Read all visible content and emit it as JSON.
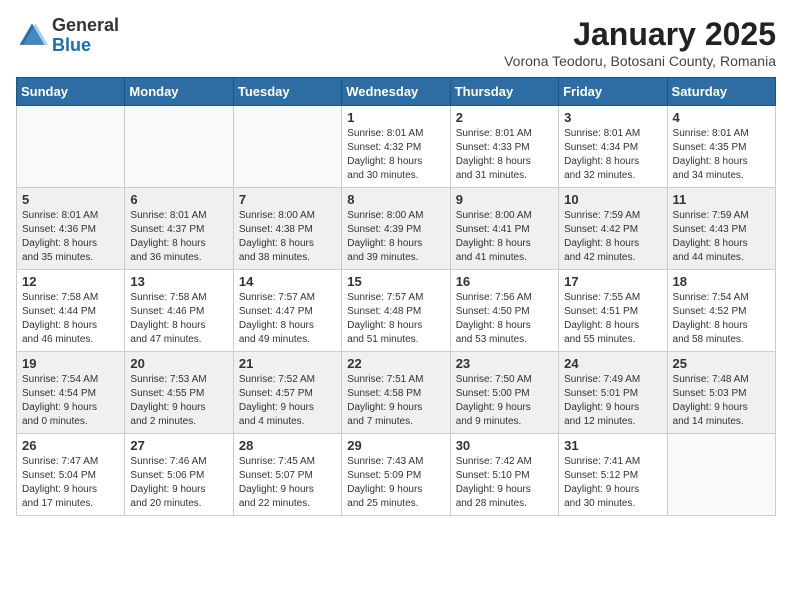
{
  "logo": {
    "general": "General",
    "blue": "Blue"
  },
  "title": "January 2025",
  "subtitle": "Vorona Teodoru, Botosani County, Romania",
  "weekdays": [
    "Sunday",
    "Monday",
    "Tuesday",
    "Wednesday",
    "Thursday",
    "Friday",
    "Saturday"
  ],
  "weeks": [
    [
      {
        "day": "",
        "info": ""
      },
      {
        "day": "",
        "info": ""
      },
      {
        "day": "",
        "info": ""
      },
      {
        "day": "1",
        "info": "Sunrise: 8:01 AM\nSunset: 4:32 PM\nDaylight: 8 hours\nand 30 minutes."
      },
      {
        "day": "2",
        "info": "Sunrise: 8:01 AM\nSunset: 4:33 PM\nDaylight: 8 hours\nand 31 minutes."
      },
      {
        "day": "3",
        "info": "Sunrise: 8:01 AM\nSunset: 4:34 PM\nDaylight: 8 hours\nand 32 minutes."
      },
      {
        "day": "4",
        "info": "Sunrise: 8:01 AM\nSunset: 4:35 PM\nDaylight: 8 hours\nand 34 minutes."
      }
    ],
    [
      {
        "day": "5",
        "info": "Sunrise: 8:01 AM\nSunset: 4:36 PM\nDaylight: 8 hours\nand 35 minutes."
      },
      {
        "day": "6",
        "info": "Sunrise: 8:01 AM\nSunset: 4:37 PM\nDaylight: 8 hours\nand 36 minutes."
      },
      {
        "day": "7",
        "info": "Sunrise: 8:00 AM\nSunset: 4:38 PM\nDaylight: 8 hours\nand 38 minutes."
      },
      {
        "day": "8",
        "info": "Sunrise: 8:00 AM\nSunset: 4:39 PM\nDaylight: 8 hours\nand 39 minutes."
      },
      {
        "day": "9",
        "info": "Sunrise: 8:00 AM\nSunset: 4:41 PM\nDaylight: 8 hours\nand 41 minutes."
      },
      {
        "day": "10",
        "info": "Sunrise: 7:59 AM\nSunset: 4:42 PM\nDaylight: 8 hours\nand 42 minutes."
      },
      {
        "day": "11",
        "info": "Sunrise: 7:59 AM\nSunset: 4:43 PM\nDaylight: 8 hours\nand 44 minutes."
      }
    ],
    [
      {
        "day": "12",
        "info": "Sunrise: 7:58 AM\nSunset: 4:44 PM\nDaylight: 8 hours\nand 46 minutes."
      },
      {
        "day": "13",
        "info": "Sunrise: 7:58 AM\nSunset: 4:46 PM\nDaylight: 8 hours\nand 47 minutes."
      },
      {
        "day": "14",
        "info": "Sunrise: 7:57 AM\nSunset: 4:47 PM\nDaylight: 8 hours\nand 49 minutes."
      },
      {
        "day": "15",
        "info": "Sunrise: 7:57 AM\nSunset: 4:48 PM\nDaylight: 8 hours\nand 51 minutes."
      },
      {
        "day": "16",
        "info": "Sunrise: 7:56 AM\nSunset: 4:50 PM\nDaylight: 8 hours\nand 53 minutes."
      },
      {
        "day": "17",
        "info": "Sunrise: 7:55 AM\nSunset: 4:51 PM\nDaylight: 8 hours\nand 55 minutes."
      },
      {
        "day": "18",
        "info": "Sunrise: 7:54 AM\nSunset: 4:52 PM\nDaylight: 8 hours\nand 58 minutes."
      }
    ],
    [
      {
        "day": "19",
        "info": "Sunrise: 7:54 AM\nSunset: 4:54 PM\nDaylight: 9 hours\nand 0 minutes."
      },
      {
        "day": "20",
        "info": "Sunrise: 7:53 AM\nSunset: 4:55 PM\nDaylight: 9 hours\nand 2 minutes."
      },
      {
        "day": "21",
        "info": "Sunrise: 7:52 AM\nSunset: 4:57 PM\nDaylight: 9 hours\nand 4 minutes."
      },
      {
        "day": "22",
        "info": "Sunrise: 7:51 AM\nSunset: 4:58 PM\nDaylight: 9 hours\nand 7 minutes."
      },
      {
        "day": "23",
        "info": "Sunrise: 7:50 AM\nSunset: 5:00 PM\nDaylight: 9 hours\nand 9 minutes."
      },
      {
        "day": "24",
        "info": "Sunrise: 7:49 AM\nSunset: 5:01 PM\nDaylight: 9 hours\nand 12 minutes."
      },
      {
        "day": "25",
        "info": "Sunrise: 7:48 AM\nSunset: 5:03 PM\nDaylight: 9 hours\nand 14 minutes."
      }
    ],
    [
      {
        "day": "26",
        "info": "Sunrise: 7:47 AM\nSunset: 5:04 PM\nDaylight: 9 hours\nand 17 minutes."
      },
      {
        "day": "27",
        "info": "Sunrise: 7:46 AM\nSunset: 5:06 PM\nDaylight: 9 hours\nand 20 minutes."
      },
      {
        "day": "28",
        "info": "Sunrise: 7:45 AM\nSunset: 5:07 PM\nDaylight: 9 hours\nand 22 minutes."
      },
      {
        "day": "29",
        "info": "Sunrise: 7:43 AM\nSunset: 5:09 PM\nDaylight: 9 hours\nand 25 minutes."
      },
      {
        "day": "30",
        "info": "Sunrise: 7:42 AM\nSunset: 5:10 PM\nDaylight: 9 hours\nand 28 minutes."
      },
      {
        "day": "31",
        "info": "Sunrise: 7:41 AM\nSunset: 5:12 PM\nDaylight: 9 hours\nand 30 minutes."
      },
      {
        "day": "",
        "info": ""
      }
    ]
  ]
}
